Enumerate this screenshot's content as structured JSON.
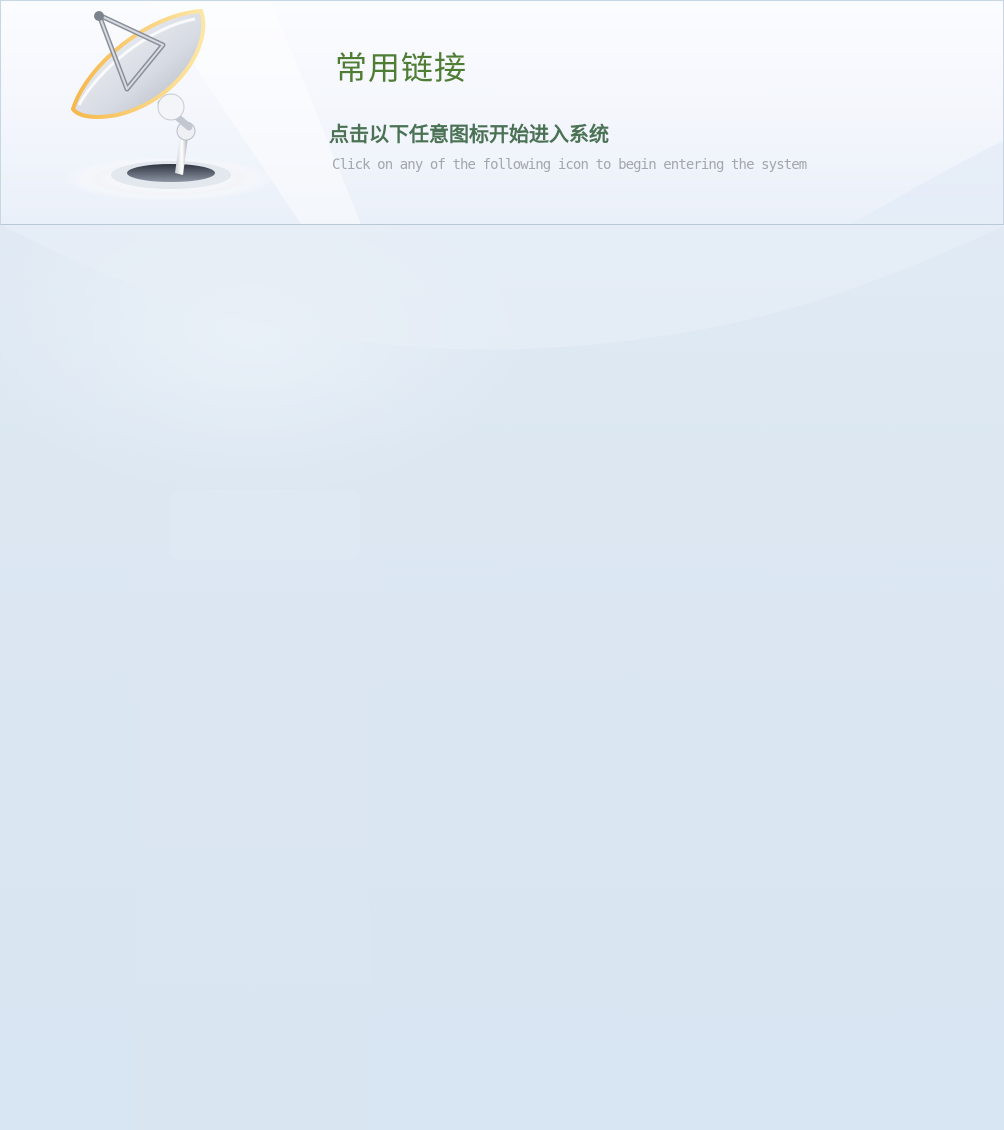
{
  "header": {
    "title": "常用链接",
    "instruction_cn": "点击以下任意图标开始进入系统",
    "instruction_en": "Click on any of the following icon to begin entering the system",
    "logo_icon": "satellite-dish-icon"
  },
  "colors": {
    "title": "#4f7d34",
    "instruction_cn": "#4b7254",
    "instruction_en": "#a3a7ab",
    "background": "#d8e5f2",
    "header_background": "#f3f6fc"
  }
}
